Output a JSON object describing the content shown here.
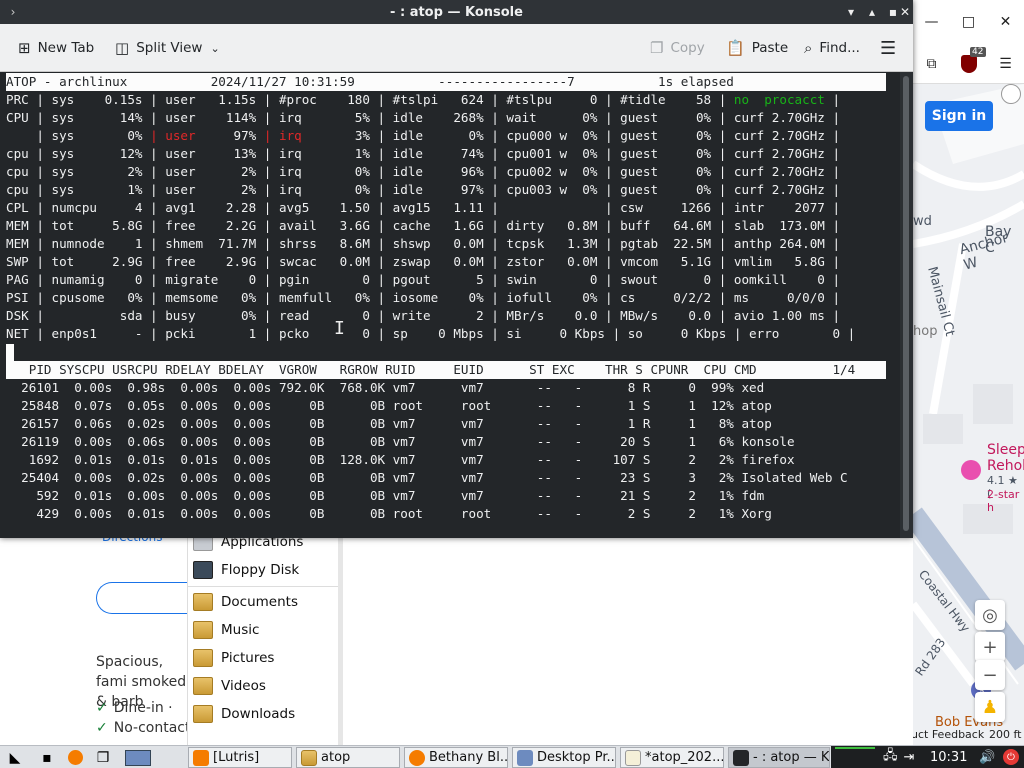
{
  "konsole": {
    "title": "- : atop — Konsole",
    "toolbar": {
      "new_tab": "New Tab",
      "split_view": "Split View",
      "copy": "Copy",
      "paste": "Paste",
      "find": "Find..."
    },
    "terminal_lines": [
      {
        "text": "ATOP - archlinux           2024/11/27 10:31:59           -----------------7           1s elapsed ",
        "inverse": true
      },
      {
        "text": "PRC | sys    0.15s | user   1.15s | #proc    180 | #tslpi   624 | #tslpu     0 | #tidle    58 | no  procacct |"
      },
      {
        "text": "CPU | sys      14% | user    114% | irq       5% | idle    268% | wait      0% | guest     0% | curf 2.70GHz |"
      },
      {
        "text": "    | sys       0% | user     97% | irq       3% | idle      0% | cpu000 w  0% | guest     0% | curf 2.70GHz |"
      },
      {
        "text": "cpu | sys      12% | user     13% | irq       1% | idle     74% | cpu001 w  0% | guest     0% | curf 2.70GHz |"
      },
      {
        "text": "cpu | sys       2% | user      2% | irq       0% | idle     96% | cpu002 w  0% | guest     0% | curf 2.70GHz |"
      },
      {
        "text": "cpu | sys       1% | user      2% | irq       0% | idle     97% | cpu003 w  0% | guest     0% | curf 2.70GHz |"
      },
      {
        "text": "CPL | numcpu     4 | avg1    2.28 | avg5    1.50 | avg15   1.11 |              | csw     1266 | intr    2077 |"
      },
      {
        "text": "MEM | tot     5.8G | free    2.2G | avail   3.6G | cache   1.6G | dirty   0.8M | buff   64.6M | slab  173.0M |"
      },
      {
        "text": "MEM | numnode    1 | shmem  71.7M | shrss   8.6M | shswp   0.0M | tcpsk   1.3M | pgtab  22.5M | anthp 264.0M |"
      },
      {
        "text": "SWP | tot     2.9G | free    2.9G | swcac   0.0M | zswap   0.0M | zstor   0.0M | vmcom   5.1G | vmlim   5.8G |"
      },
      {
        "text": "PAG | numamig    0 | migrate    0 | pgin       0 | pgout      5 | swin       0 | swout      0 | oomkill    0 |"
      },
      {
        "text": "PSI | cpusome   0% | memsome   0% | memfull   0% | iosome    0% | iofull    0% | cs     0/2/2 | ms     0/0/0 |"
      },
      {
        "text": "DSK |          sda | busy      0% | read       0 | write      2 | MBr/s    0.0 | MBw/s    0.0 | avio 1.00 ms |"
      },
      {
        "text": "NET | enp0s1     - | pcki       1 | pcko       0 | sp    0 Mbps | si     0 Kbps | so     0 Kbps | erro       0 |"
      },
      {
        "text": ""
      },
      {
        "text": "   PID SYSCPU USRCPU RDELAY BDELAY  VGROW   RGROW RUID     EUID      ST EXC    THR S CPUNR  CPU CMD          1/4",
        "inverse": true
      },
      {
        "text": "  26101  0.00s  0.98s  0.00s  0.00s 792.0K  768.0K vm7      vm7       --   -      8 R     0  99% xed"
      },
      {
        "text": "  25848  0.07s  0.05s  0.00s  0.00s     0B      0B root     root      --   -      1 S     1  12% atop"
      },
      {
        "text": "  26157  0.06s  0.02s  0.00s  0.00s     0B      0B vm7      vm7       --   -      1 R     1   8% atop"
      },
      {
        "text": "  26119  0.00s  0.06s  0.00s  0.00s     0B      0B vm7      vm7       --   -     20 S     1   6% konsole"
      },
      {
        "text": "   1692  0.01s  0.01s  0.01s  0.00s     0B  128.0K vm7      vm7       --   -    107 S     2   2% firefox"
      },
      {
        "text": "  25404  0.00s  0.02s  0.00s  0.00s     0B      0B vm7      vm7       --   -     23 S     3   2% Isolated Web C"
      },
      {
        "text": "    592  0.01s  0.00s  0.00s  0.00s     0B      0B vm7      vm7       --   -     21 S     2   1% fdm"
      },
      {
        "text": "    429  0.00s  0.01s  0.00s  0.00s     0B      0B root     root      --   -      2 S     2   1% Xorg"
      }
    ]
  },
  "file_manager": {
    "items": [
      {
        "label": "Applications",
        "icon": "applications-icon"
      },
      {
        "label": "Floppy Disk",
        "icon": "floppy-icon"
      },
      {
        "label": "Documents",
        "icon": "folder-icon"
      },
      {
        "label": "Music",
        "icon": "folder-icon"
      },
      {
        "label": "Pictures",
        "icon": "folder-icon"
      },
      {
        "label": "Videos",
        "icon": "folder-icon"
      },
      {
        "label": "Downloads",
        "icon": "folder-icon"
      }
    ]
  },
  "webpage": {
    "directions": "Directions",
    "description": "Spacious, fami smoked & barb",
    "dine_in": "Dine-in ·",
    "no_contact": "No-contact"
  },
  "browser": {
    "signin": "Sign in",
    "extension_badge": "42",
    "map": {
      "bay_label": "Bay C",
      "anchor_label": "Anchor W",
      "mainsail_label": "Mainsail Ct",
      "hop_label": "hop",
      "wd_label": "wd",
      "sleep_label": "Sleep",
      "rehob_label": "Rehob",
      "rating_label": "4.1 ★ (",
      "star_label": "2-star h",
      "coastal_label": "Coastal Hwy",
      "rd_label": "Rd 283",
      "bob_evans_label": "Bob Evans",
      "feedback_label": "uct Feedback",
      "scale_label": "200 ft"
    }
  },
  "taskbar": {
    "tasks": [
      {
        "label": "[Lutris]"
      },
      {
        "label": "atop"
      },
      {
        "label": "Bethany Bl..."
      },
      {
        "label": "Desktop Pr..."
      },
      {
        "label": "*atop_202..."
      },
      {
        "label": "- : atop — K..."
      }
    ],
    "clock": "10:31"
  },
  "colors": {
    "terminal_bg": "#232629",
    "terminal_fg": "#eff0f1",
    "highlight_red": "#e02828",
    "highlight_green": "#18b218",
    "accent_blue": "#1a73e8"
  }
}
